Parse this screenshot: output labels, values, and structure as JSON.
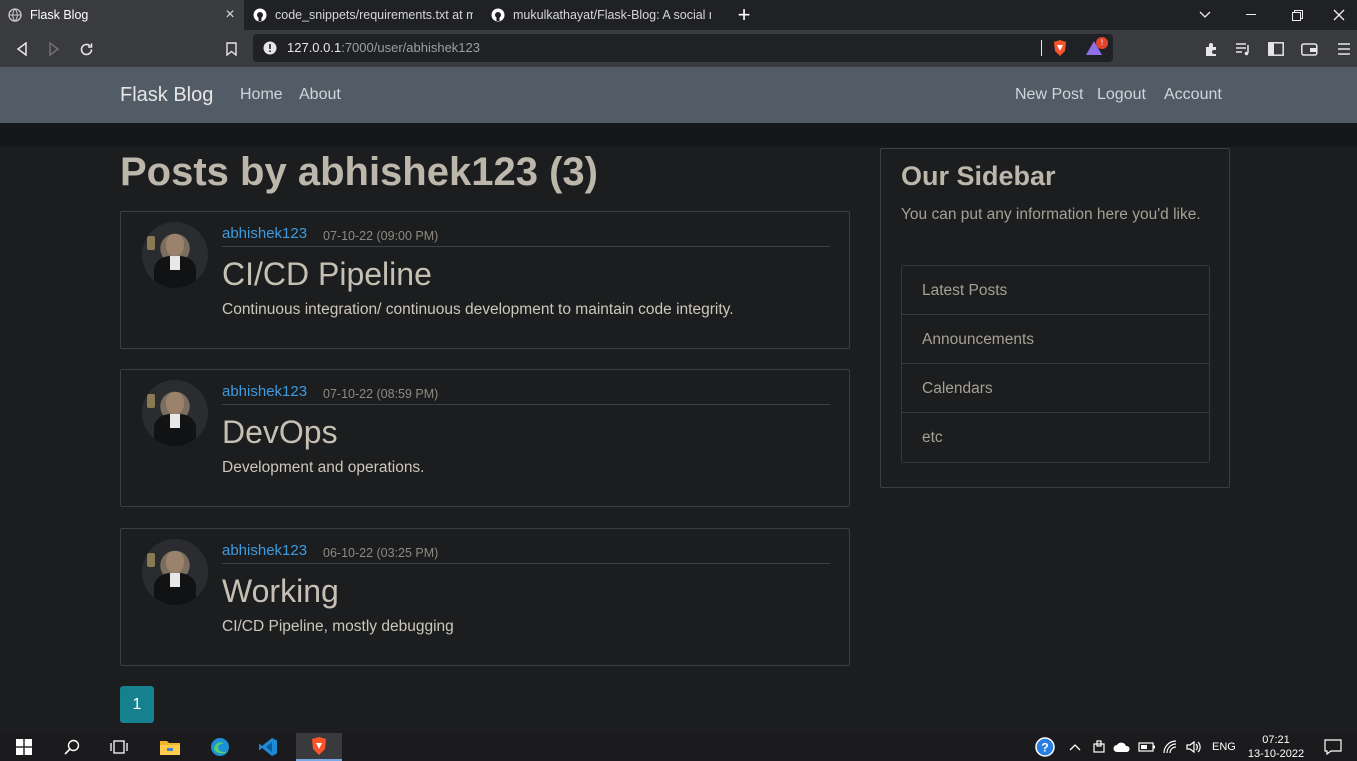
{
  "browser": {
    "tabs": [
      {
        "title": "Flask Blog",
        "active": true
      },
      {
        "title": "code_snippets/requirements.txt at ma",
        "active": false
      },
      {
        "title": "mukulkathayat/Flask-Blog: A social me",
        "active": false
      }
    ],
    "url_host": "127.0.0.1",
    "url_rest": ":7000/user/abhishek123",
    "shields_badge": "!"
  },
  "site": {
    "brand": "Flask Blog",
    "nav_left": [
      "Home",
      "About"
    ],
    "nav_right": [
      "New Post",
      "Logout",
      "Account"
    ]
  },
  "main": {
    "heading": "Posts by abhishek123 (3)",
    "posts": [
      {
        "author": "abhishek123",
        "date": "07-10-22 (09:00 PM)",
        "title": "CI/CD Pipeline",
        "content": "Continuous integration/ continuous development to maintain code integrity."
      },
      {
        "author": "abhishek123",
        "date": "07-10-22 (08:59 PM)",
        "title": "DevOps",
        "content": "Development and operations."
      },
      {
        "author": "abhishek123",
        "date": "06-10-22 (03:25 PM)",
        "title": "Working",
        "content": "CI/CD Pipeline, mostly debugging"
      }
    ],
    "pagination": [
      "1"
    ]
  },
  "sidebar": {
    "title": "Our Sidebar",
    "text": "You can put any information here you'd like.",
    "items": [
      "Latest Posts",
      "Announcements",
      "Calendars",
      "etc"
    ]
  },
  "taskbar": {
    "lang": "ENG",
    "time": "07:21",
    "date": "13-10-2022"
  },
  "colors": {
    "navbar": "#515c66",
    "accent_link": "#3d9be0",
    "page_button": "#17808f",
    "background": "#1c1d1f"
  }
}
